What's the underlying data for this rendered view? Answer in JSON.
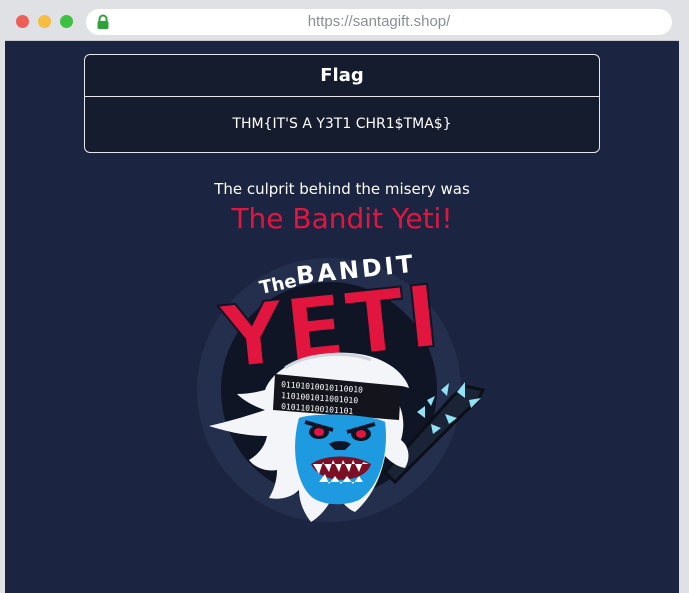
{
  "browser": {
    "url": "https://santagift.shop/"
  },
  "flag_card": {
    "title": "Flag",
    "value": "THM{IT'S A Y3T1 CHR1$TMA$}"
  },
  "culprit": {
    "label": "The culprit behind the misery was",
    "name": "The Bandit Yeti!"
  },
  "logo": {
    "text_the": "The",
    "text_bandit": "BANDIT",
    "text_yeti": "YETI",
    "binary_row_1": "01101010010110010",
    "binary_row_2": "1101001011001010",
    "binary_row_3": "010110100101101",
    "colors": {
      "red": "#e2153f",
      "yeti_blue": "#1e9be0",
      "fur": "#f3f5f8",
      "circle": "#232f4d"
    }
  }
}
